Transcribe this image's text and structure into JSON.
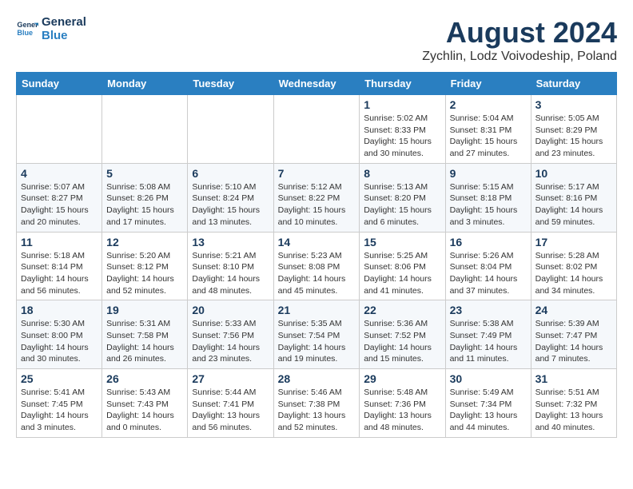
{
  "header": {
    "logo_line1": "General",
    "logo_line2": "Blue",
    "month": "August 2024",
    "location": "Zychlin, Lodz Voivodeship, Poland"
  },
  "weekdays": [
    "Sunday",
    "Monday",
    "Tuesday",
    "Wednesday",
    "Thursday",
    "Friday",
    "Saturday"
  ],
  "weeks": [
    [
      {
        "day": "",
        "sunrise": "",
        "sunset": "",
        "daylight": ""
      },
      {
        "day": "",
        "sunrise": "",
        "sunset": "",
        "daylight": ""
      },
      {
        "day": "",
        "sunrise": "",
        "sunset": "",
        "daylight": ""
      },
      {
        "day": "",
        "sunrise": "",
        "sunset": "",
        "daylight": ""
      },
      {
        "day": "1",
        "sunrise": "Sunrise: 5:02 AM",
        "sunset": "Sunset: 8:33 PM",
        "daylight": "Daylight: 15 hours and 30 minutes."
      },
      {
        "day": "2",
        "sunrise": "Sunrise: 5:04 AM",
        "sunset": "Sunset: 8:31 PM",
        "daylight": "Daylight: 15 hours and 27 minutes."
      },
      {
        "day": "3",
        "sunrise": "Sunrise: 5:05 AM",
        "sunset": "Sunset: 8:29 PM",
        "daylight": "Daylight: 15 hours and 23 minutes."
      }
    ],
    [
      {
        "day": "4",
        "sunrise": "Sunrise: 5:07 AM",
        "sunset": "Sunset: 8:27 PM",
        "daylight": "Daylight: 15 hours and 20 minutes."
      },
      {
        "day": "5",
        "sunrise": "Sunrise: 5:08 AM",
        "sunset": "Sunset: 8:26 PM",
        "daylight": "Daylight: 15 hours and 17 minutes."
      },
      {
        "day": "6",
        "sunrise": "Sunrise: 5:10 AM",
        "sunset": "Sunset: 8:24 PM",
        "daylight": "Daylight: 15 hours and 13 minutes."
      },
      {
        "day": "7",
        "sunrise": "Sunrise: 5:12 AM",
        "sunset": "Sunset: 8:22 PM",
        "daylight": "Daylight: 15 hours and 10 minutes."
      },
      {
        "day": "8",
        "sunrise": "Sunrise: 5:13 AM",
        "sunset": "Sunset: 8:20 PM",
        "daylight": "Daylight: 15 hours and 6 minutes."
      },
      {
        "day": "9",
        "sunrise": "Sunrise: 5:15 AM",
        "sunset": "Sunset: 8:18 PM",
        "daylight": "Daylight: 15 hours and 3 minutes."
      },
      {
        "day": "10",
        "sunrise": "Sunrise: 5:17 AM",
        "sunset": "Sunset: 8:16 PM",
        "daylight": "Daylight: 14 hours and 59 minutes."
      }
    ],
    [
      {
        "day": "11",
        "sunrise": "Sunrise: 5:18 AM",
        "sunset": "Sunset: 8:14 PM",
        "daylight": "Daylight: 14 hours and 56 minutes."
      },
      {
        "day": "12",
        "sunrise": "Sunrise: 5:20 AM",
        "sunset": "Sunset: 8:12 PM",
        "daylight": "Daylight: 14 hours and 52 minutes."
      },
      {
        "day": "13",
        "sunrise": "Sunrise: 5:21 AM",
        "sunset": "Sunset: 8:10 PM",
        "daylight": "Daylight: 14 hours and 48 minutes."
      },
      {
        "day": "14",
        "sunrise": "Sunrise: 5:23 AM",
        "sunset": "Sunset: 8:08 PM",
        "daylight": "Daylight: 14 hours and 45 minutes."
      },
      {
        "day": "15",
        "sunrise": "Sunrise: 5:25 AM",
        "sunset": "Sunset: 8:06 PM",
        "daylight": "Daylight: 14 hours and 41 minutes."
      },
      {
        "day": "16",
        "sunrise": "Sunrise: 5:26 AM",
        "sunset": "Sunset: 8:04 PM",
        "daylight": "Daylight: 14 hours and 37 minutes."
      },
      {
        "day": "17",
        "sunrise": "Sunrise: 5:28 AM",
        "sunset": "Sunset: 8:02 PM",
        "daylight": "Daylight: 14 hours and 34 minutes."
      }
    ],
    [
      {
        "day": "18",
        "sunrise": "Sunrise: 5:30 AM",
        "sunset": "Sunset: 8:00 PM",
        "daylight": "Daylight: 14 hours and 30 minutes."
      },
      {
        "day": "19",
        "sunrise": "Sunrise: 5:31 AM",
        "sunset": "Sunset: 7:58 PM",
        "daylight": "Daylight: 14 hours and 26 minutes."
      },
      {
        "day": "20",
        "sunrise": "Sunrise: 5:33 AM",
        "sunset": "Sunset: 7:56 PM",
        "daylight": "Daylight: 14 hours and 23 minutes."
      },
      {
        "day": "21",
        "sunrise": "Sunrise: 5:35 AM",
        "sunset": "Sunset: 7:54 PM",
        "daylight": "Daylight: 14 hours and 19 minutes."
      },
      {
        "day": "22",
        "sunrise": "Sunrise: 5:36 AM",
        "sunset": "Sunset: 7:52 PM",
        "daylight": "Daylight: 14 hours and 15 minutes."
      },
      {
        "day": "23",
        "sunrise": "Sunrise: 5:38 AM",
        "sunset": "Sunset: 7:49 PM",
        "daylight": "Daylight: 14 hours and 11 minutes."
      },
      {
        "day": "24",
        "sunrise": "Sunrise: 5:39 AM",
        "sunset": "Sunset: 7:47 PM",
        "daylight": "Daylight: 14 hours and 7 minutes."
      }
    ],
    [
      {
        "day": "25",
        "sunrise": "Sunrise: 5:41 AM",
        "sunset": "Sunset: 7:45 PM",
        "daylight": "Daylight: 14 hours and 3 minutes."
      },
      {
        "day": "26",
        "sunrise": "Sunrise: 5:43 AM",
        "sunset": "Sunset: 7:43 PM",
        "daylight": "Daylight: 14 hours and 0 minutes."
      },
      {
        "day": "27",
        "sunrise": "Sunrise: 5:44 AM",
        "sunset": "Sunset: 7:41 PM",
        "daylight": "Daylight: 13 hours and 56 minutes."
      },
      {
        "day": "28",
        "sunrise": "Sunrise: 5:46 AM",
        "sunset": "Sunset: 7:38 PM",
        "daylight": "Daylight: 13 hours and 52 minutes."
      },
      {
        "day": "29",
        "sunrise": "Sunrise: 5:48 AM",
        "sunset": "Sunset: 7:36 PM",
        "daylight": "Daylight: 13 hours and 48 minutes."
      },
      {
        "day": "30",
        "sunrise": "Sunrise: 5:49 AM",
        "sunset": "Sunset: 7:34 PM",
        "daylight": "Daylight: 13 hours and 44 minutes."
      },
      {
        "day": "31",
        "sunrise": "Sunrise: 5:51 AM",
        "sunset": "Sunset: 7:32 PM",
        "daylight": "Daylight: 13 hours and 40 minutes."
      }
    ]
  ]
}
